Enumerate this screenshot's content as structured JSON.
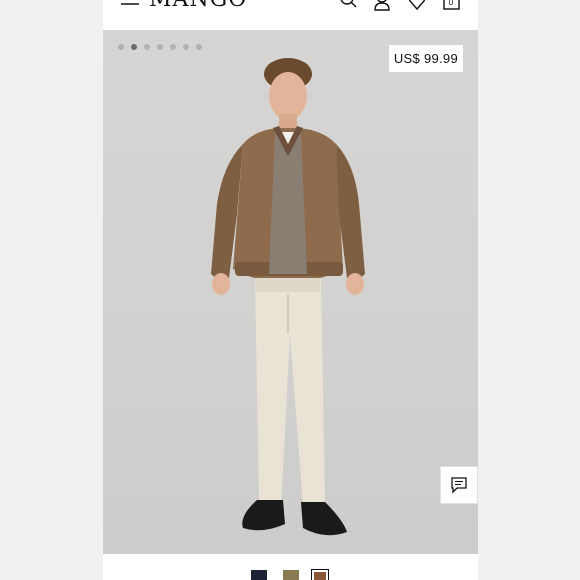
{
  "header": {
    "logo_text": "MANGO",
    "icons": [
      "menu-icon",
      "search-icon",
      "account-icon",
      "wishlist-icon",
      "shopping-bag-icon"
    ],
    "bag_count": "0"
  },
  "gallery": {
    "image_count": 7,
    "active_index": 1,
    "price": "US$ 99.99"
  },
  "product": {
    "colors": [
      {
        "name": "navy",
        "hex": "#1c2135"
      },
      {
        "name": "brown",
        "hex": "#8a7a52"
      },
      {
        "name": "camel",
        "hex": "#8a5a38",
        "selected": true
      }
    ]
  }
}
